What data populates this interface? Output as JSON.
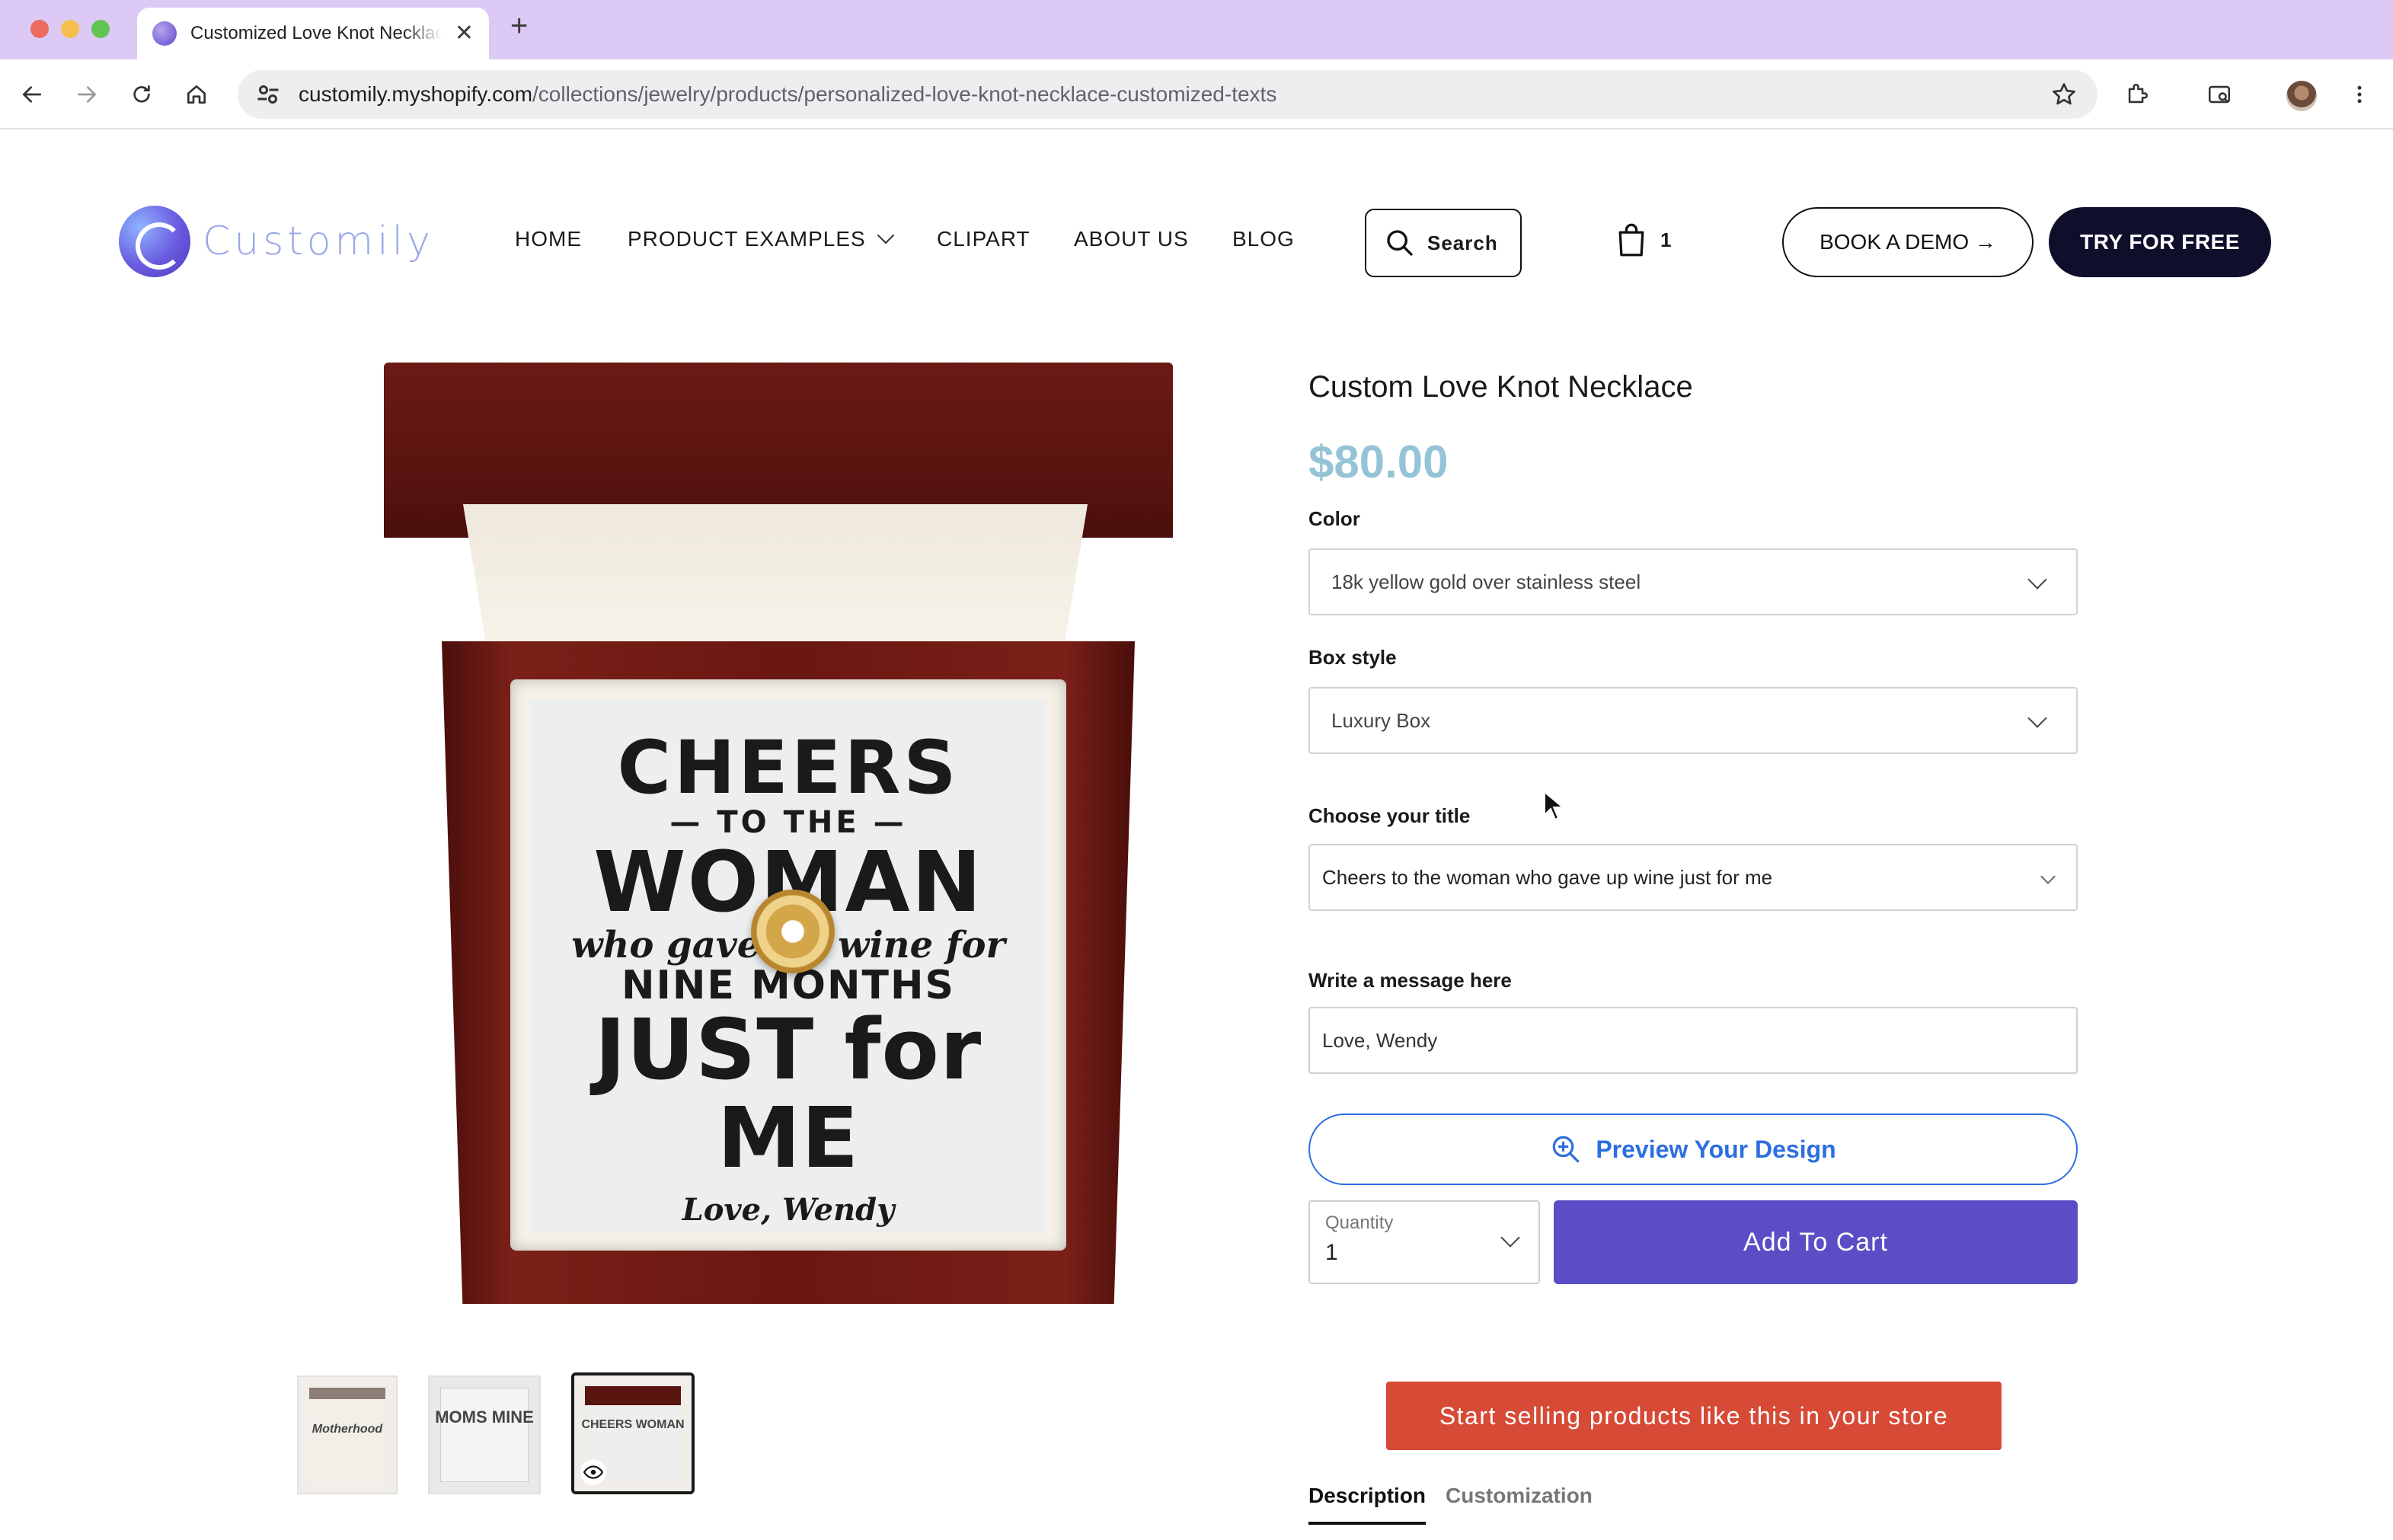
{
  "browser": {
    "tab_title": "Customized Love Knot Necklace",
    "tab_close": "✕",
    "new_tab": "+",
    "url_host": "customily.myshopify.com",
    "url_path": "/collections/jewelry/products/personalized-love-knot-necklace-customized-texts"
  },
  "header": {
    "logo_text": "Customily",
    "nav": [
      "HOME",
      "PRODUCT EXAMPLES",
      "CLIPART",
      "ABOUT US",
      "BLOG"
    ],
    "search_label": "Search",
    "cart_count": "1",
    "book_demo": "BOOK A DEMO →",
    "try_free": "TRY FOR FREE"
  },
  "card": {
    "line1": "CHEERS",
    "line2": "— TO THE —",
    "line3": "WOMAN",
    "line4": "who gave up wine for",
    "line5": "NINE MONTHS",
    "line6": "JUST for ME",
    "line7": "Love, Wendy"
  },
  "thumbnails": [
    {
      "text": "Motherhood"
    },
    {
      "text": "MOMS MINE"
    },
    {
      "text": "CHEERS WOMAN"
    }
  ],
  "product": {
    "title": "Custom Love Knot Necklace",
    "price": "$80.00",
    "color_label": "Color",
    "color_value": "18k yellow gold over stainless steel",
    "box_label": "Box style",
    "box_value": "Luxury Box",
    "title_label": "Choose your title",
    "title_value": "Cheers to the woman who gave up wine just for me",
    "message_label": "Write a message here",
    "message_value": "Love, Wendy",
    "preview_button": "Preview Your Design",
    "quantity_label": "Quantity",
    "quantity_value": "1",
    "add_to_cart": "Add To Cart",
    "promo": "Start selling products like this in your store",
    "tabs": [
      "Description",
      "Customization"
    ]
  },
  "colors": {
    "accent_purple": "#5a4dc6",
    "price_blue": "#94c4d6",
    "promo_red": "#d64a36",
    "preview_blue": "#2d6ee0"
  }
}
